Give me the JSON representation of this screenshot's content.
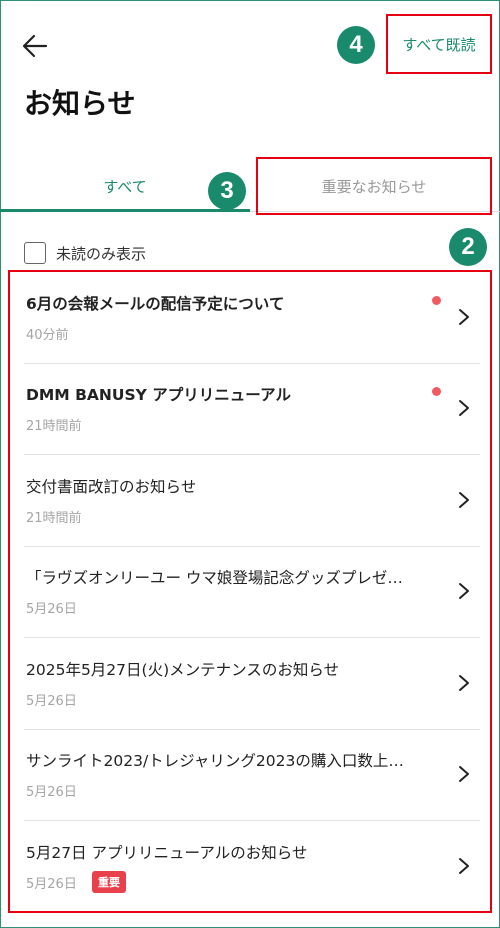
{
  "header": {
    "mark_all_read": "すべて既読",
    "title": "お知らせ"
  },
  "tabs": [
    {
      "label": "すべて",
      "active": true
    },
    {
      "label": "重要なお知らせ",
      "active": false
    }
  ],
  "filter": {
    "unread_only_label": "未読のみ表示",
    "checked": false
  },
  "callouts": {
    "n2": "2",
    "n3": "3",
    "n4": "4"
  },
  "notices": [
    {
      "title": "6月の会報メールの配信予定について",
      "date": "40分前",
      "unread": true,
      "bold": true
    },
    {
      "title": "DMM BANUSY アプリリニューアル",
      "date": "21時間前",
      "unread": true,
      "bold": true
    },
    {
      "title": "交付書面改訂のお知らせ",
      "date": "21時間前",
      "unread": false,
      "bold": false
    },
    {
      "title": "「ラヴズオンリーユー ウマ娘登場記念グッズプレゼ…",
      "date": "5月26日",
      "unread": false,
      "bold": false
    },
    {
      "title": "2025年5月27日(火)メンテナンスのお知らせ",
      "date": "5月26日",
      "unread": false,
      "bold": false
    },
    {
      "title": "サンライト2023/トレジャリング2023の購入口数上…",
      "date": "5月26日",
      "unread": false,
      "bold": false
    },
    {
      "title": "5月27日 アプリリニューアルのお知らせ",
      "date": "5月26日",
      "unread": false,
      "bold": false,
      "badge": "重要"
    }
  ],
  "colors": {
    "accent": "#1a8a6c",
    "highlight_box": "#e60012",
    "unread_dot": "#f25a63",
    "badge": "#e8414b"
  }
}
